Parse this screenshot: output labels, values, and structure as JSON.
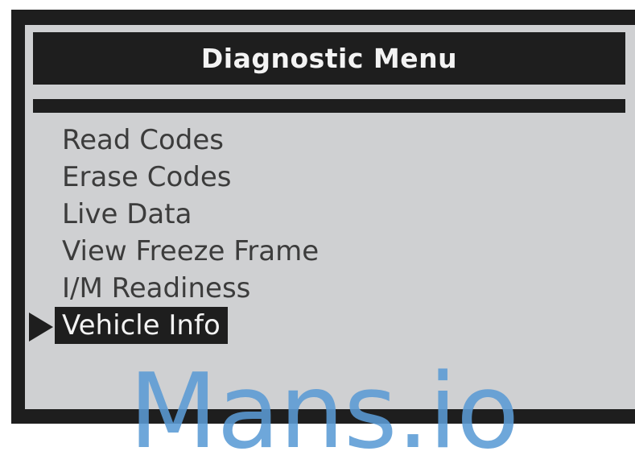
{
  "header": {
    "title": "Diagnostic Menu"
  },
  "menu": {
    "items": [
      {
        "label": "Read Codes"
      },
      {
        "label": "Erase Codes"
      },
      {
        "label": "Live Data"
      },
      {
        "label": "View Freeze Frame"
      },
      {
        "label": "I/M Readiness"
      },
      {
        "label": "Vehicle Info"
      }
    ],
    "selected_index": 5,
    "cursor_icon": "triangle-right-icon"
  },
  "watermark": {
    "text": "Mans.io"
  },
  "colors": {
    "bezel": "#1e1e1e",
    "screen": "#cfd0d2",
    "text": "#3c3c3c",
    "highlight_text": "#f3f3f3",
    "watermark": "#5b9bd5"
  }
}
